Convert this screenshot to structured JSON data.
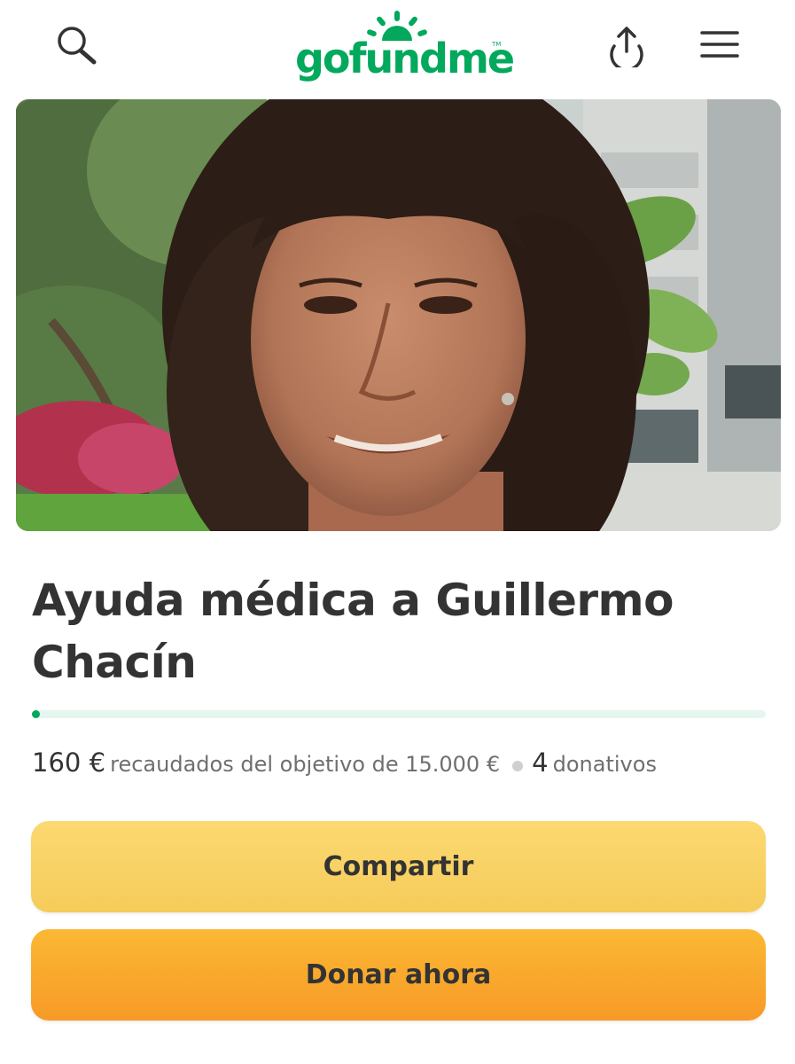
{
  "header": {
    "logo_text": "gofundme",
    "logo_tm": "TM",
    "icons": {
      "search": "search-icon",
      "share": "upload-share-icon",
      "menu": "hamburger-menu-icon"
    },
    "brand_color": "#02a95c"
  },
  "campaign": {
    "title": "Ayuda médica a Guillermo Chacín",
    "raised": "160 €",
    "raised_text": "recaudados del objetivo de 15.000 €",
    "donations_count": "4",
    "donations_label": "donativos",
    "progress_fraction": 0.0107
  },
  "actions": {
    "share_label": "Compartir",
    "donate_label": "Donar ahora",
    "share_color": "#f6cb5a",
    "donate_color": "#f79a27"
  }
}
